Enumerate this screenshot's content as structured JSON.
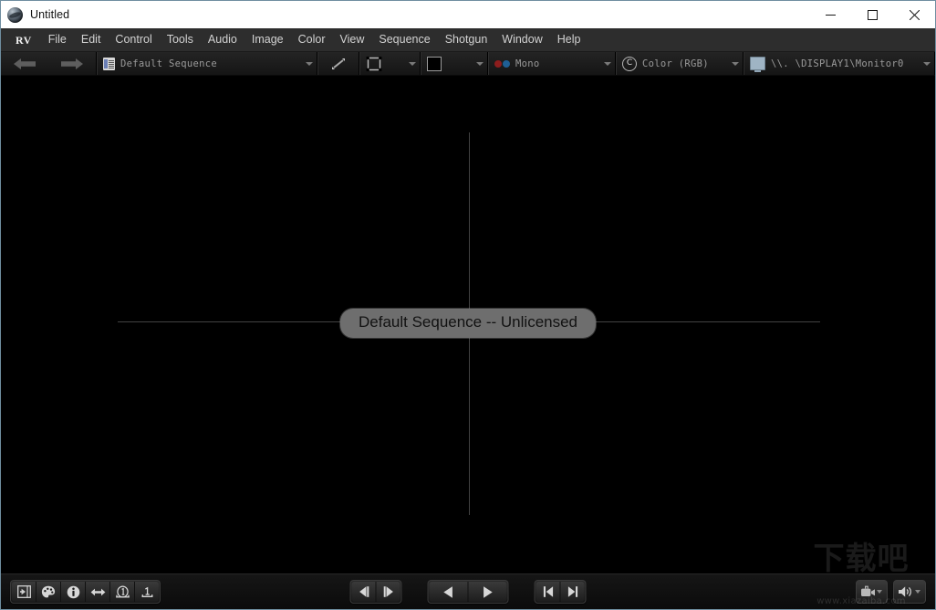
{
  "window": {
    "title": "Untitled",
    "app_icon": "rv-globe-icon",
    "minimize_label": "Minimize",
    "maximize_label": "Maximize",
    "close_label": "Close"
  },
  "menubar": {
    "items": [
      {
        "label": "RV",
        "name": "menu-rv"
      },
      {
        "label": "File",
        "name": "menu-file"
      },
      {
        "label": "Edit",
        "name": "menu-edit"
      },
      {
        "label": "Control",
        "name": "menu-control"
      },
      {
        "label": "Tools",
        "name": "menu-tools"
      },
      {
        "label": "Audio",
        "name": "menu-audio"
      },
      {
        "label": "Image",
        "name": "menu-image"
      },
      {
        "label": "Color",
        "name": "menu-color"
      },
      {
        "label": "View",
        "name": "menu-view"
      },
      {
        "label": "Sequence",
        "name": "menu-sequence"
      },
      {
        "label": "Shotgun",
        "name": "menu-shotgun"
      },
      {
        "label": "Window",
        "name": "menu-window"
      },
      {
        "label": "Help",
        "name": "menu-help"
      }
    ]
  },
  "toolbar": {
    "back_icon": "back-arrow-icon",
    "forward_icon": "forward-arrow-icon",
    "sequence_value": "Default Sequence",
    "sequence_icon": "sequence-document-icon",
    "resize_icon": "resize-diagonal-icon",
    "frame_icon": "frame-fit-icon",
    "background_swatch": "#000000",
    "stereo_value": "Mono",
    "stereo_icon": "anaglyph-dots-icon",
    "color_value": "Color (RGB)",
    "color_icon": "color-c-icon",
    "display_value": "\\\\. \\DISPLAY1\\Monitor0",
    "display_icon": "monitor-icon"
  },
  "viewport": {
    "center_label": "Default Sequence -- Unlicensed",
    "crosshair_color": "#6a6a6a"
  },
  "watermark": {
    "brand": "下载吧",
    "url": "www.xiazaiba.com"
  },
  "bottombar": {
    "left_tools": [
      {
        "name": "toggle-panel-button",
        "icon": "panel-toggle-icon"
      },
      {
        "name": "color-palette-button",
        "icon": "color-palette-icon"
      },
      {
        "name": "info-button",
        "icon": "info-circle-icon"
      },
      {
        "name": "swap-button",
        "icon": "bidirectional-arrow-icon"
      },
      {
        "name": "frame-number-button",
        "icon": "circled-one-icon"
      },
      {
        "name": "range-one-button",
        "icon": "one-with-bar-icon"
      }
    ],
    "transport": [
      {
        "name": "step-back-button",
        "icon": "step-backward-icon"
      },
      {
        "name": "step-forward-button",
        "icon": "step-forward-icon"
      },
      {
        "name": "play-reverse-button",
        "icon": "play-reverse-icon"
      },
      {
        "name": "play-forward-button",
        "icon": "play-forward-icon"
      },
      {
        "name": "go-to-start-button",
        "icon": "skip-to-start-icon"
      },
      {
        "name": "go-to-end-button",
        "icon": "skip-to-end-icon"
      }
    ],
    "right_tools": [
      {
        "name": "video-device-button",
        "icon": "video-camera-icon"
      },
      {
        "name": "volume-button",
        "icon": "speaker-volume-icon"
      }
    ]
  }
}
